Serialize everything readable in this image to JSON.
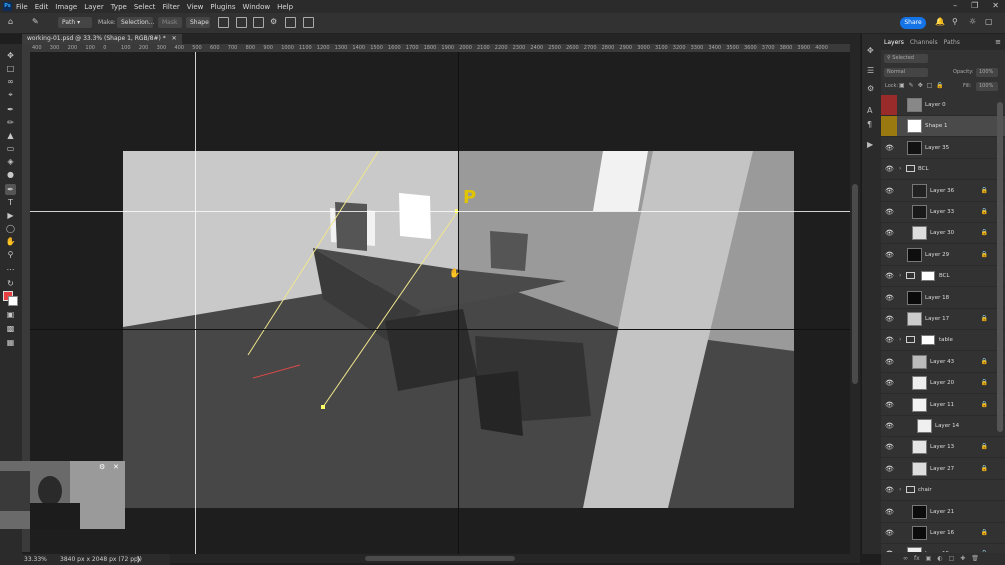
{
  "app": {
    "logo": "Ps"
  },
  "menu": [
    "File",
    "Edit",
    "Image",
    "Layer",
    "Type",
    "Select",
    "Filter",
    "View",
    "Plugins",
    "Window",
    "Help"
  ],
  "options": {
    "path_mode": "Path",
    "make_label": "Make:",
    "selection_btn": "Selection...",
    "mask_btn": "Mask",
    "shape_btn": "Shape",
    "share_btn": "Share"
  },
  "document": {
    "tab_title": "working-01.psd @ 33.3% (Shape 1, RGB/8#) *",
    "zoom": "33.33%",
    "size_info": "3840 px x 2048 px (72 ppi)"
  },
  "ruler_labels": [
    "400",
    "300",
    "200",
    "100",
    "0",
    "100",
    "200",
    "300",
    "400",
    "500",
    "600",
    "700",
    "800",
    "900",
    "1000",
    "1100",
    "1200",
    "1300",
    "1400",
    "1500",
    "1600",
    "1700",
    "1800",
    "1900",
    "2000",
    "2100",
    "2200",
    "2300",
    "2400",
    "2500",
    "2600",
    "2700",
    "2800",
    "2900",
    "3000",
    "3100",
    "3200",
    "3300",
    "3400",
    "3500",
    "3600",
    "3700",
    "3800",
    "3900",
    "4000"
  ],
  "canvas": {
    "annotation": "P"
  },
  "layers_panel": {
    "tabs": [
      "Layers",
      "Channels",
      "Paths"
    ],
    "kind_filter": "Selected",
    "blend_mode": "Normal",
    "opacity_label": "Opacity:",
    "opacity_value": "100%",
    "lock_label": "Lock:",
    "fill_label": "Fill:",
    "fill_value": "100%",
    "layers": [
      {
        "name": "Layer 0",
        "eye": "",
        "eye_color": "#9a2b2b",
        "type": "layer",
        "thumb": "#888888",
        "indent": 0,
        "lock": false,
        "selected": false
      },
      {
        "name": "Shape 1",
        "eye": "",
        "eye_color": "#9a7a10",
        "type": "shape",
        "thumb": "#ffffff",
        "indent": 0,
        "lock": false,
        "selected": true
      },
      {
        "name": "Layer 35",
        "eye": "👁",
        "eye_color": "",
        "type": "layer",
        "thumb": "#111111",
        "indent": 0,
        "lock": false,
        "selected": false
      },
      {
        "name": "BCL",
        "eye": "👁",
        "eye_color": "",
        "type": "group",
        "thumb": "",
        "indent": 0,
        "lock": false,
        "selected": false
      },
      {
        "name": "Layer 36",
        "eye": "👁",
        "eye_color": "",
        "type": "layer",
        "thumb": "#222222",
        "indent": 1,
        "lock": true,
        "selected": false
      },
      {
        "name": "Layer 33",
        "eye": "👁",
        "eye_color": "",
        "type": "layer",
        "thumb": "#1a1a1a",
        "indent": 1,
        "lock": true,
        "selected": false
      },
      {
        "name": "Layer 30",
        "eye": "👁",
        "eye_color": "",
        "type": "layer",
        "thumb": "#dddddd",
        "indent": 1,
        "lock": true,
        "selected": false
      },
      {
        "name": "Layer 29",
        "eye": "👁",
        "eye_color": "",
        "type": "layer",
        "thumb": "#0e0e0e",
        "indent": 0,
        "lock": true,
        "selected": false
      },
      {
        "name": "BCL",
        "eye": "👁",
        "eye_color": "",
        "type": "group-mask",
        "thumb": "",
        "indent": 0,
        "lock": false,
        "selected": false
      },
      {
        "name": "Layer 18",
        "eye": "👁",
        "eye_color": "",
        "type": "layer",
        "thumb": "#0a0a0a",
        "indent": 0,
        "lock": false,
        "selected": false
      },
      {
        "name": "Layer 17",
        "eye": "👁",
        "eye_color": "",
        "type": "layer",
        "thumb": "#cccccc",
        "indent": 0,
        "lock": true,
        "selected": false
      },
      {
        "name": "table",
        "eye": "👁",
        "eye_color": "",
        "type": "group-mask",
        "thumb": "",
        "indent": 0,
        "lock": false,
        "selected": false
      },
      {
        "name": "Layer 43",
        "eye": "👁",
        "eye_color": "",
        "type": "layer",
        "thumb": "#bbbbbb",
        "indent": 1,
        "lock": true,
        "selected": false
      },
      {
        "name": "Layer 20",
        "eye": "👁",
        "eye_color": "",
        "type": "layer",
        "thumb": "#eeeeee",
        "indent": 1,
        "lock": true,
        "selected": false
      },
      {
        "name": "Layer 11",
        "eye": "👁",
        "eye_color": "",
        "type": "layer",
        "thumb": "#f2f2f2",
        "indent": 1,
        "lock": true,
        "selected": false
      },
      {
        "name": "Layer 14",
        "eye": "👁",
        "eye_color": "",
        "type": "layer",
        "thumb": "#f0f0f0",
        "indent": 2,
        "lock": false,
        "selected": false
      },
      {
        "name": "Layer 13",
        "eye": "👁",
        "eye_color": "",
        "type": "layer",
        "thumb": "#e5e5e5",
        "indent": 1,
        "lock": true,
        "selected": false
      },
      {
        "name": "Layer 27",
        "eye": "👁",
        "eye_color": "",
        "type": "layer",
        "thumb": "#dddddd",
        "indent": 1,
        "lock": true,
        "selected": false
      },
      {
        "name": "chair",
        "eye": "👁",
        "eye_color": "",
        "type": "group",
        "thumb": "",
        "indent": 0,
        "lock": false,
        "selected": false
      },
      {
        "name": "Layer 21",
        "eye": "👁",
        "eye_color": "",
        "type": "layer",
        "thumb": "#0c0c0c",
        "indent": 1,
        "lock": false,
        "selected": false
      },
      {
        "name": "Layer 16",
        "eye": "👁",
        "eye_color": "",
        "type": "layer",
        "thumb": "#0c0c0c",
        "indent": 1,
        "lock": true,
        "selected": false
      },
      {
        "name": "Layer 15",
        "eye": "👁",
        "eye_color": "",
        "type": "layer",
        "thumb": "#eeeeee",
        "indent": 0,
        "lock": true,
        "selected": false
      },
      {
        "name": "Layer 45",
        "eye": "",
        "eye_color": "#9a2b2b",
        "type": "layer",
        "thumb": "#e8e8e8",
        "indent": 0,
        "lock": false,
        "selected": false
      }
    ]
  },
  "colors": {
    "accent": "#1473e6",
    "foreground": "#e84040",
    "background": "#ffffff",
    "guide": "#ffffff",
    "path": "#f0e68c"
  }
}
